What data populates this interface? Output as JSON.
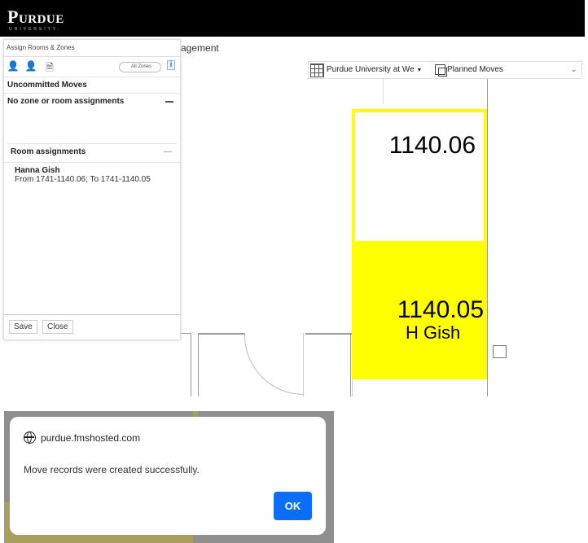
{
  "header": {
    "logo_main": "Purdue",
    "logo_sub": "UNIVERSITY."
  },
  "nav": {
    "partial_title": "agement"
  },
  "panel": {
    "title": "Assign Rooms & Zones",
    "toolbar_icons": [
      "person-search-icon",
      "person-assign-icon",
      "report-icon"
    ],
    "all_zones_toggle": "All Zones",
    "info_label": "i",
    "uncommitted_header": "Uncommitted Moves",
    "no_zone_header": "No zone or room assignments",
    "room_assignments_header": "Room assignments",
    "assignments": [
      {
        "name": "Hanna Gish",
        "detail": "From 1741-1140.06; To 1741-1140.05"
      }
    ],
    "save_label": "Save",
    "close_label": "Close"
  },
  "map_toolbar": {
    "site_select": "Purdue University at We",
    "layer_select": "Planned Moves"
  },
  "floorplan": {
    "rooms": [
      {
        "number": "1140.06",
        "occupant": "",
        "highlight": "#ffff00",
        "style": "outline"
      },
      {
        "number": "1140.05",
        "occupant": "H Gish",
        "highlight": "#ffff00",
        "style": "filled"
      }
    ]
  },
  "dialog": {
    "origin": "purdue.fmshosted.com",
    "message": "Move records were created successfully.",
    "ok_label": "OK",
    "accent": "#0b6ef7"
  }
}
